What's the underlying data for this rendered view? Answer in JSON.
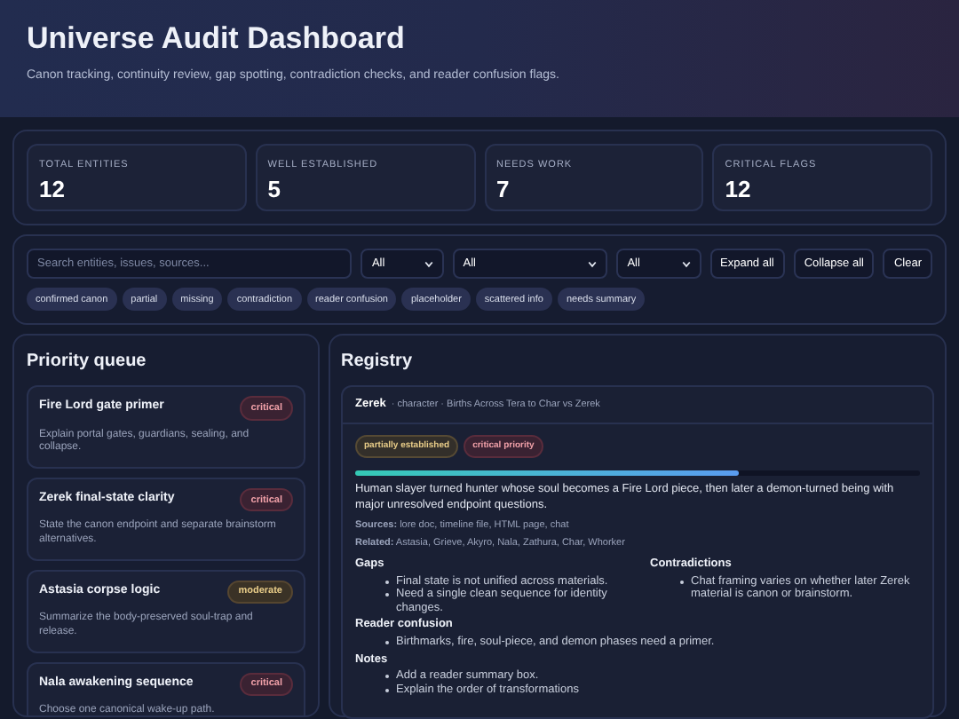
{
  "header": {
    "title": "Universe Audit Dashboard",
    "subtitle": "Canon tracking, continuity review, gap spotting, contradiction checks, and reader confusion flags."
  },
  "stats": [
    {
      "label": "TOTAL ENTITIES",
      "value": "12"
    },
    {
      "label": "WELL ESTABLISHED",
      "value": "5"
    },
    {
      "label": "NEEDS WORK",
      "value": "7"
    },
    {
      "label": "CRITICAL FLAGS",
      "value": "12"
    }
  ],
  "filters": {
    "search": {
      "placeholder": "Search entities, issues, sources..."
    },
    "selects": [
      {
        "value": "All"
      },
      {
        "value": "All"
      },
      {
        "value": "All"
      }
    ],
    "buttons": [
      "Expand all",
      "Collapse all",
      "Clear"
    ],
    "tags": [
      "confirmed canon",
      "partial",
      "missing",
      "contradiction",
      "reader confusion",
      "placeholder",
      "scattered info",
      "needs summary"
    ]
  },
  "priority_queue": {
    "title": "Priority queue",
    "items": [
      {
        "title": "Fire Lord gate primer",
        "severity": "critical",
        "description": "Explain portal gates, guardians, sealing, and collapse."
      },
      {
        "title": "Zerek final-state clarity",
        "severity": "critical",
        "description": "State the canon endpoint and separate brainstorm alternatives."
      },
      {
        "title": "Astasia corpse logic",
        "severity": "moderate",
        "description": "Summarize the body-preserved soul-trap and release."
      },
      {
        "title": "Nala awakening sequence",
        "severity": "critical",
        "description": "Choose one canonical wake-up path."
      }
    ]
  },
  "registry": {
    "title": "Registry",
    "entry": {
      "name": "Zerek",
      "meta": "· character · Births Across Tera to Char vs Zerek",
      "badges": [
        {
          "label": "partially established",
          "kind": "partial"
        },
        {
          "label": "critical priority",
          "kind": "critical"
        }
      ],
      "level": 0.68,
      "summary": "Human slayer turned hunter whose soul becomes a Fire Lord piece, then later a demon-turned being with major unresolved endpoint questions.",
      "sources": {
        "label": "Sources:",
        "value": "lore doc, timeline file, HTML page, chat"
      },
      "related": {
        "label": "Related:",
        "value": "Astasia, Grieve, Akyro, Nala, Zathura, Char, Whorker"
      },
      "gaps": {
        "title": "Gaps",
        "items": [
          "Final state is not unified across materials.",
          "Need a single clean sequence for identity changes."
        ]
      },
      "contradictions": {
        "title": "Contradictions",
        "items": [
          "Chat framing varies on whether later Zerek material is canon or brainstorm."
        ]
      },
      "reader_confusion": {
        "title": "Reader confusion",
        "items": [
          "Birthmarks, fire, soul-piece, and demon phases need a primer."
        ]
      },
      "notes": {
        "title": "Notes",
        "items": [
          "Add a reader summary box.",
          "Explain the order of transformations"
        ]
      }
    }
  }
}
